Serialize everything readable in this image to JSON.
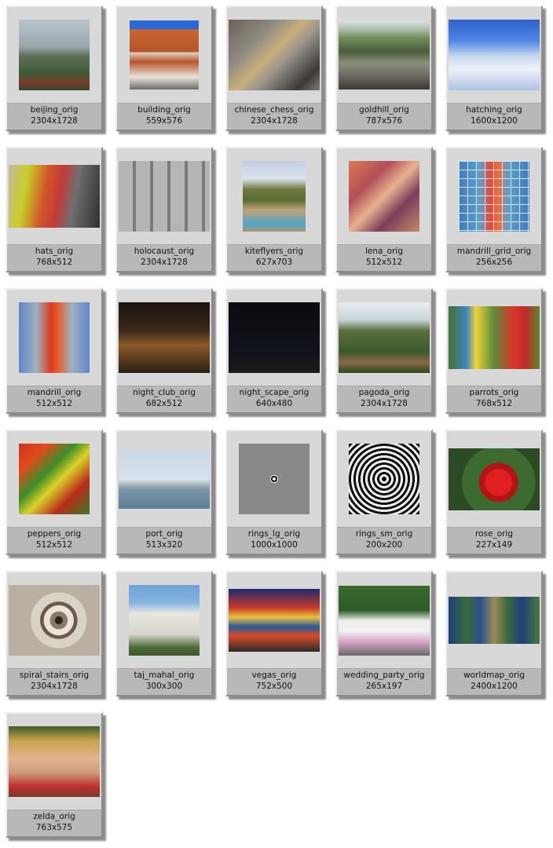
{
  "items": [
    {
      "name": "beijing_orig",
      "size": "2304x1728"
    },
    {
      "name": "building_orig",
      "size": "559x576"
    },
    {
      "name": "chinese_chess_orig",
      "size": "2304x1728"
    },
    {
      "name": "goldhill_orig",
      "size": "787x576"
    },
    {
      "name": "hatching_orig",
      "size": "1600x1200"
    },
    {
      "name": "hats_orig",
      "size": "768x512"
    },
    {
      "name": "holocaust_orig",
      "size": "2304x1728"
    },
    {
      "name": "kiteflyers_orig",
      "size": "627x703"
    },
    {
      "name": "lena_orig",
      "size": "512x512"
    },
    {
      "name": "mandrill_grid_orig",
      "size": "256x256"
    },
    {
      "name": "mandrill_orig",
      "size": "512x512"
    },
    {
      "name": "night_club_orig",
      "size": "682x512"
    },
    {
      "name": "night_scape_orig",
      "size": "640x480"
    },
    {
      "name": "pagoda_orig",
      "size": "2304x1728"
    },
    {
      "name": "parrots_orig",
      "size": "768x512"
    },
    {
      "name": "peppers_orig",
      "size": "512x512"
    },
    {
      "name": "port_orig",
      "size": "513x320"
    },
    {
      "name": "rings_lg_orig",
      "size": "1000x1000"
    },
    {
      "name": "rings_sm_orig",
      "size": "200x200"
    },
    {
      "name": "rose_orig",
      "size": "227x149"
    },
    {
      "name": "spiral_stairs_orig",
      "size": "2304x1728"
    },
    {
      "name": "taj_mahal_orig",
      "size": "300x300"
    },
    {
      "name": "vegas_orig",
      "size": "752x500"
    },
    {
      "name": "wedding_party_orig",
      "size": "265x197"
    },
    {
      "name": "worldmap_orig",
      "size": "2400x1200"
    },
    {
      "name": "zelda_orig",
      "size": "763x575"
    }
  ]
}
